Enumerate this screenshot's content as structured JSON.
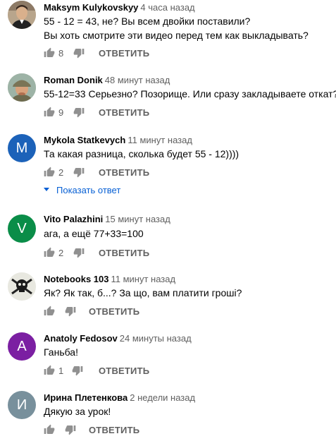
{
  "actions": {
    "reply_label": "ОТВЕТИТЬ"
  },
  "comments": [
    {
      "author": "Maksym Kulykovskyy",
      "time": "4 часа назад",
      "text_lines": [
        "55 - 12 = 43, не? Вы всем двойки поставили?",
        "Вы хоть смотрите эти видео перед тем как выкладывать?"
      ],
      "likes": "8",
      "avatar": "photo-man"
    },
    {
      "author": "Roman Donik",
      "time": "48 минут назад",
      "text_lines": [
        "55-12=33 Серьезно? Позорище. Или сразу закладываете откат?"
      ],
      "likes": "9",
      "avatar": "photo-cap"
    },
    {
      "author": "Mykola Statkevych",
      "time": "11 минут назад",
      "text_lines": [
        "Та какая разница, сколька будет 55 - 12))))"
      ],
      "likes": "2",
      "avatar_letter": "M",
      "avatar_color": "#1c62b9",
      "show_replies": "Показать ответ"
    },
    {
      "author": "Vito Palazhini",
      "time": "15 минут назад",
      "text_lines": [
        "ага, а ещё 77+33=100"
      ],
      "likes": "2",
      "avatar_letter": "V",
      "avatar_color": "#0a8d48"
    },
    {
      "author": "Notebooks 103",
      "time": "11 минут назад",
      "text_lines": [
        "Як? Як так, б...? За що, вам платити гроші?"
      ],
      "likes": "",
      "avatar": "skull"
    },
    {
      "author": "Anatoly Fedosov",
      "time": "24 минуты назад",
      "text_lines": [
        "Ганьба!"
      ],
      "likes": "1",
      "avatar_letter": "A",
      "avatar_color": "#7b1fa2"
    },
    {
      "author": "Ирина Плетенкова",
      "time": "2 недели назад",
      "text_lines": [
        "Дякую за урок!"
      ],
      "likes": "",
      "avatar_letter": "И",
      "avatar_color": "#78909c"
    }
  ]
}
